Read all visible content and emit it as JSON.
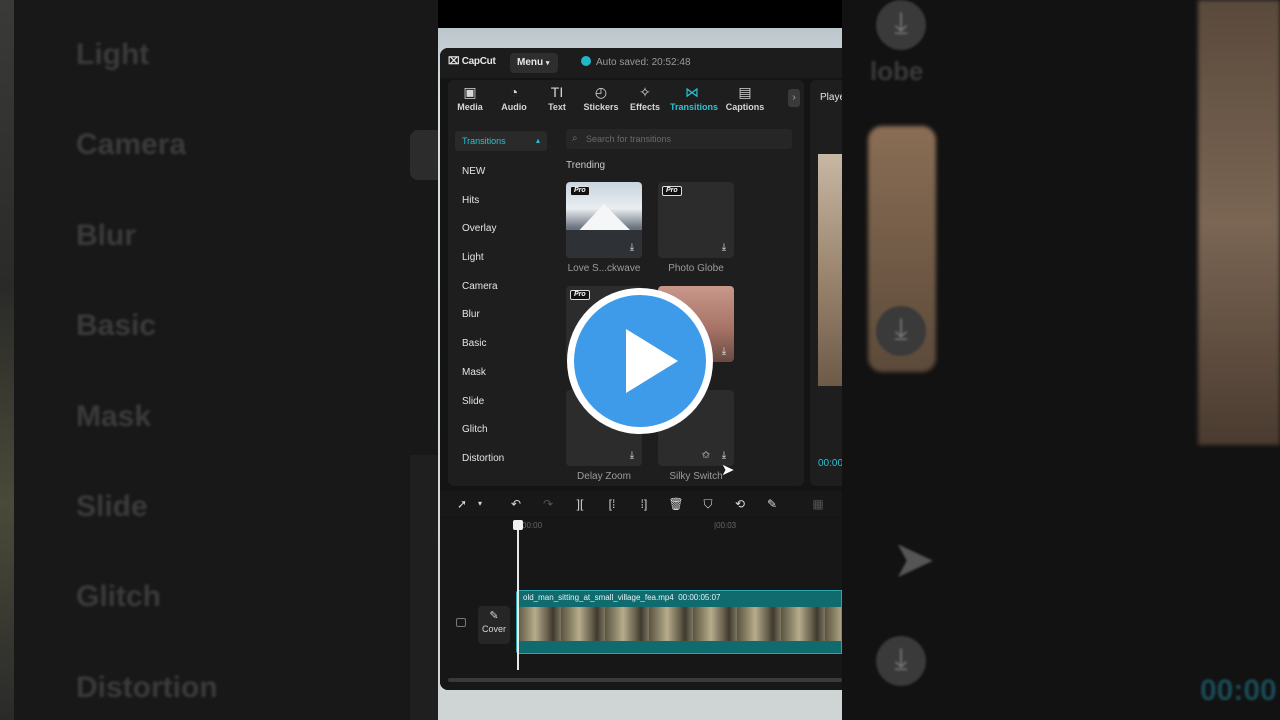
{
  "app": {
    "logo": "CapCut",
    "menu_label": "Menu",
    "auto_saved": "Auto saved: 20:52:48"
  },
  "tabs": [
    {
      "label": "Media",
      "icon": "media-icon"
    },
    {
      "label": "Audio",
      "icon": "audio-icon"
    },
    {
      "label": "Text",
      "icon": "text-icon"
    },
    {
      "label": "Stickers",
      "icon": "stickers-icon"
    },
    {
      "label": "Effects",
      "icon": "effects-icon"
    },
    {
      "label": "Transitions",
      "icon": "transitions-icon",
      "active": true
    },
    {
      "label": "Captions",
      "icon": "captions-icon"
    }
  ],
  "sidebar": {
    "dropdown_label": "Transitions",
    "categories": [
      "NEW",
      "Hits",
      "Overlay",
      "Light",
      "Camera",
      "Blur",
      "Basic",
      "Mask",
      "Slide",
      "Glitch",
      "Distortion"
    ]
  },
  "search": {
    "placeholder": "Search for transitions"
  },
  "section_title": "Trending",
  "cards": [
    {
      "label": "Love S...ckwave",
      "badge": "Pro"
    },
    {
      "label": "Photo Globe",
      "badge": "Pro"
    },
    {
      "label": "",
      "badge": "Pro"
    },
    {
      "label": "",
      "badge": ""
    },
    {
      "label": "Delay Zoom",
      "badge": ""
    },
    {
      "label": "Silky Switch",
      "badge": ""
    }
  ],
  "player": {
    "title": "Playe",
    "timecode": "00:00"
  },
  "timeline": {
    "ruler": [
      "00:00",
      "|00:03"
    ],
    "cover_label": "Cover",
    "clip_name": "old_man_sitting_at_small_village_fea.mp4",
    "clip_duration": "00:00:05:07"
  },
  "background": {
    "left_list": [
      "Light",
      "Camera",
      "Blur",
      "Basic",
      "Mask",
      "Slide",
      "Glitch",
      "Distortion"
    ],
    "right_title": "lobe",
    "right_timecode": "00:00"
  },
  "colors": {
    "accent": "#27c4d6",
    "play_button": "#3d9be9",
    "clip": "#0f6b6e"
  }
}
